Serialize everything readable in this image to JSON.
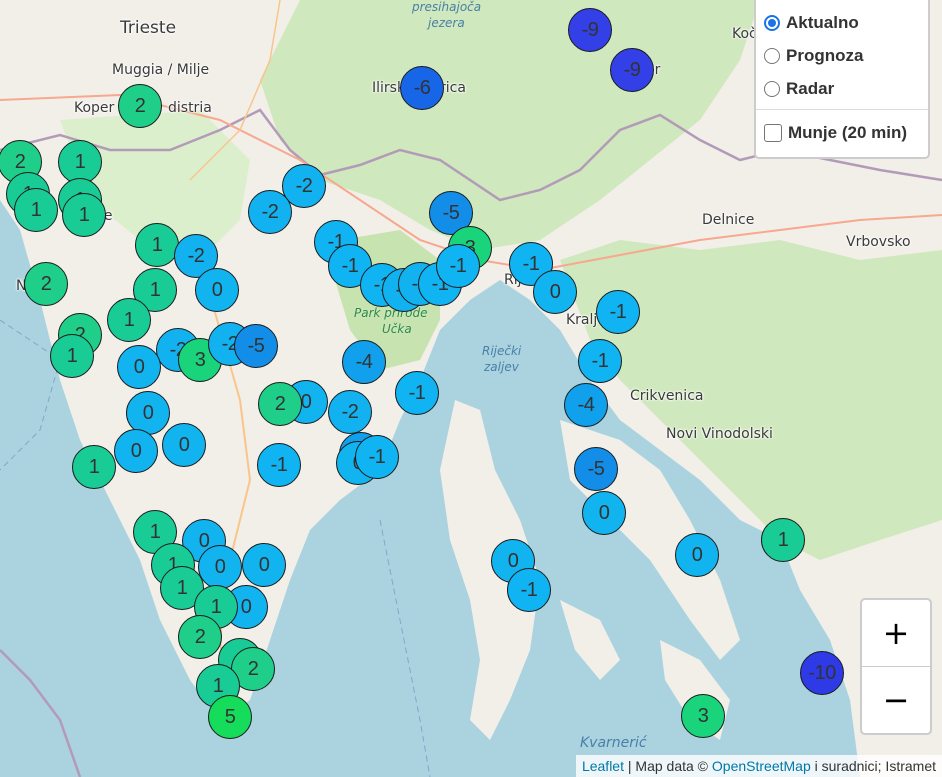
{
  "layers": {
    "options": [
      {
        "label": "Aktualno",
        "selected": true
      },
      {
        "label": "Prognoza",
        "selected": false
      },
      {
        "label": "Radar",
        "selected": false
      }
    ],
    "overlay": {
      "label": "Munje (20 min)",
      "checked": false
    }
  },
  "zoom": {
    "in": "+",
    "out": "−"
  },
  "attribution": {
    "leaflet": "Leaflet",
    "separator": " | Map data © ",
    "osm": "OpenStreetMap",
    "suffix": " i suradnici; Istramet"
  },
  "places": {
    "trieste": "Trieste",
    "muggia": "Muggia / Milje",
    "koper": "Koper",
    "distria": "distria",
    "presihajoca": "presihajoča",
    "jezera": "jezera",
    "ilirska": "Ilirsk",
    "rica": "rica",
    "kocevje": "Koč",
    "delnice": "Delnice",
    "vrbovsko": "Vrbovsko",
    "park1": "Park prirode",
    "park2": "Učka",
    "rijecki": "Riječki",
    "zaljev": "zaljev",
    "kraljevica": "Kralj",
    "crikvenica": "Crikvenica",
    "novi": "Novi Vinodolski",
    "kvarneric": "Kvarnerić",
    "novigrad": "N",
    "rijeka": "Rij",
    "ar": "ar",
    "je": "je"
  },
  "station_colors": {
    "t-10": "#2e3ae6",
    "t-9": "#3340e8",
    "t-6": "#1766e8",
    "t-5": "#138ee8",
    "t-4": "#10a0ec",
    "t-2": "#12b2f0",
    "t-1": "#10b4f2",
    "t0": "#12b4f0",
    "t1": "#19cc96",
    "t2": "#1fcf89",
    "t3": "#1ad47c",
    "t5": "#16dc5c"
  },
  "stations": [
    {
      "t": "-9"
    },
    {
      "t": "-9"
    },
    {
      "t": "-6"
    },
    {
      "t": "2"
    },
    {
      "t": "2"
    },
    {
      "t": "1"
    },
    {
      "t": "1"
    },
    {
      "t": "1"
    },
    {
      "t": "1"
    },
    {
      "t": "1"
    },
    {
      "t": "-2"
    },
    {
      "t": "-2"
    },
    {
      "t": "-5"
    },
    {
      "t": "-1"
    },
    {
      "t": "-1"
    },
    {
      "t": "3"
    },
    {
      "t": "-1"
    },
    {
      "t": "-1"
    },
    {
      "t": "-2"
    },
    {
      "t": "-2"
    },
    {
      "t": "-1"
    },
    {
      "t": "-1"
    },
    {
      "t": "0"
    },
    {
      "t": "-1"
    },
    {
      "t": "1"
    },
    {
      "t": "-2"
    },
    {
      "t": "1"
    },
    {
      "t": "0"
    },
    {
      "t": "2"
    },
    {
      "t": "1"
    },
    {
      "t": "2"
    },
    {
      "t": "1"
    },
    {
      "t": "-2"
    },
    {
      "t": "3"
    },
    {
      "t": "-2"
    },
    {
      "t": "-5"
    },
    {
      "t": "0"
    },
    {
      "t": "-4"
    },
    {
      "t": "-1"
    },
    {
      "t": "-1"
    },
    {
      "t": "0"
    },
    {
      "t": "-4"
    },
    {
      "t": "2"
    },
    {
      "t": "-2"
    },
    {
      "t": "0"
    },
    {
      "t": "0"
    },
    {
      "t": "-4"
    },
    {
      "t": "0"
    },
    {
      "t": "1"
    },
    {
      "t": "0"
    },
    {
      "t": "-1"
    },
    {
      "t": "-1"
    },
    {
      "t": "-5"
    },
    {
      "t": "0"
    },
    {
      "t": "1"
    },
    {
      "t": "0"
    },
    {
      "t": "1"
    },
    {
      "t": "0"
    },
    {
      "t": "0"
    },
    {
      "t": "0"
    },
    {
      "t": "0"
    },
    {
      "t": "-1"
    },
    {
      "t": "1"
    },
    {
      "t": "1"
    },
    {
      "t": "0"
    },
    {
      "t": "1"
    },
    {
      "t": "2"
    },
    {
      "t": "1"
    },
    {
      "t": "2"
    },
    {
      "t": "1"
    },
    {
      "t": "5"
    },
    {
      "t": "-10"
    },
    {
      "t": "3"
    }
  ]
}
